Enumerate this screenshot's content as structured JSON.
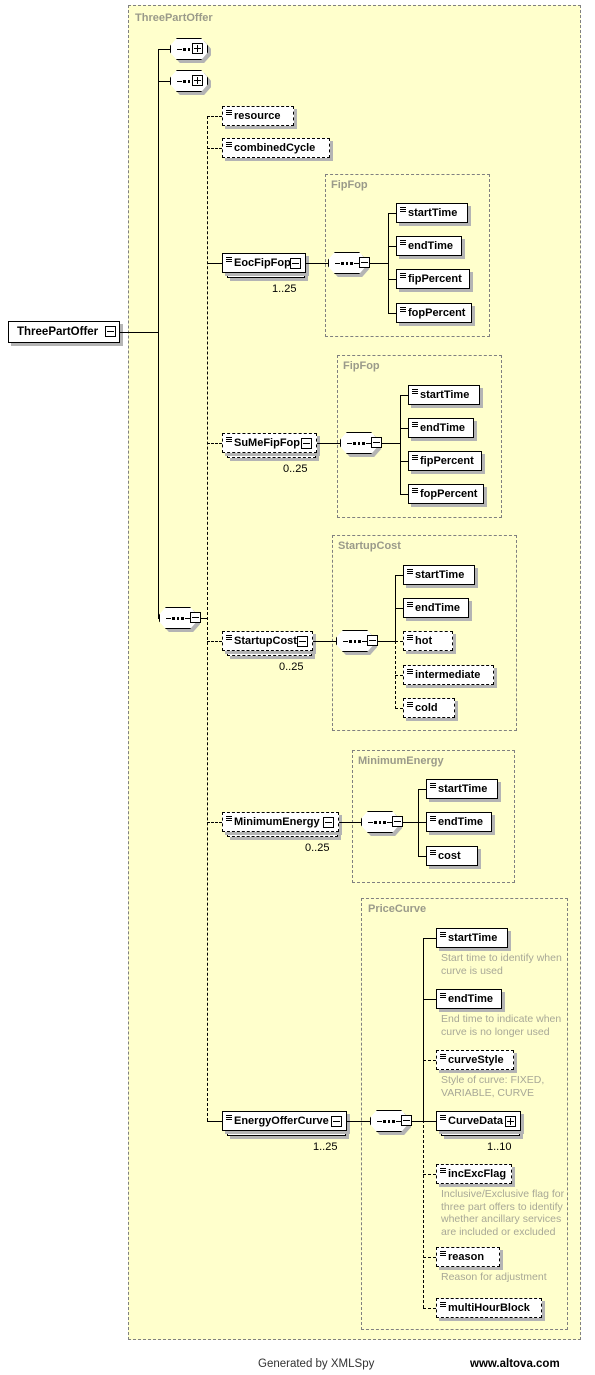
{
  "diagram": {
    "root": {
      "label": "ThreePartOffer",
      "toggle": "minus"
    },
    "container_label": "ThreePartOffer",
    "colors": {
      "background": "#ffffcc",
      "page": "#ffffff",
      "line": "#000000",
      "group_border": "#808080",
      "group_label": "#9a9a8a",
      "annotation": "#a8a897",
      "shadow": "#b4b4b4"
    },
    "collapsed_sequences": [
      {
        "name": "sequence-group-1",
        "toggle": "plus"
      },
      {
        "name": "sequence-group-2",
        "toggle": "plus"
      }
    ],
    "main_sequence": {
      "toggle": "minus"
    },
    "top_optional_elements": [
      {
        "label": "resource",
        "optional": true
      },
      {
        "label": "combinedCycle",
        "optional": true
      }
    ],
    "groups": [
      {
        "id": "eoc-fipfop",
        "group_label": "FipFop",
        "parent": {
          "label": "EocFipFop",
          "occurrence": "1..25",
          "optional": false,
          "toggle": "minus"
        },
        "children": [
          {
            "label": "startTime",
            "optional": false
          },
          {
            "label": "endTime",
            "optional": false
          },
          {
            "label": "fipPercent",
            "optional": false
          },
          {
            "label": "fopPercent",
            "optional": false
          }
        ]
      },
      {
        "id": "sume-fipfop",
        "group_label": "FipFop",
        "parent": {
          "label": "SuMeFipFop",
          "occurrence": "0..25",
          "optional": true,
          "toggle": "minus"
        },
        "children": [
          {
            "label": "startTime",
            "optional": false
          },
          {
            "label": "endTime",
            "optional": false
          },
          {
            "label": "fipPercent",
            "optional": false
          },
          {
            "label": "fopPercent",
            "optional": false
          }
        ]
      },
      {
        "id": "startup-cost",
        "group_label": "StartupCost",
        "parent": {
          "label": "StartupCost",
          "occurrence": "0..25",
          "optional": true,
          "toggle": "minus"
        },
        "children": [
          {
            "label": "startTime",
            "optional": false
          },
          {
            "label": "endTime",
            "optional": false
          },
          {
            "label": "hot",
            "optional": true
          },
          {
            "label": "intermediate",
            "optional": true
          },
          {
            "label": "cold",
            "optional": true
          }
        ]
      },
      {
        "id": "minimum-energy",
        "group_label": "MinimumEnergy",
        "parent": {
          "label": "MinimumEnergy",
          "occurrence": "0..25",
          "optional": true,
          "toggle": "minus"
        },
        "children": [
          {
            "label": "startTime",
            "optional": false
          },
          {
            "label": "endTime",
            "optional": false
          },
          {
            "label": "cost",
            "optional": false
          }
        ]
      },
      {
        "id": "price-curve",
        "group_label": "PriceCurve",
        "parent": {
          "label": "EnergyOfferCurve",
          "occurrence": "1..25",
          "optional": false,
          "toggle": "minus"
        },
        "children": [
          {
            "label": "startTime",
            "optional": false,
            "annotation": "Start time to identify when curve is used"
          },
          {
            "label": "endTime",
            "optional": false,
            "annotation": "End time to indicate when curve is no longer used"
          },
          {
            "label": "curveStyle",
            "optional": true,
            "annotation": "Style of curve: FIXED, VARIABLE, CURVE"
          },
          {
            "label": "CurveData",
            "optional": false,
            "occurrence": "1..10",
            "toggle": "plus"
          },
          {
            "label": "incExcFlag",
            "optional": true,
            "annotation": "Inclusive/Exclusive flag for three part offers to identify whether ancillary services are included or excluded"
          },
          {
            "label": "reason",
            "optional": true,
            "annotation": "Reason for adjustment"
          },
          {
            "label": "multiHourBlock",
            "optional": true
          }
        ]
      }
    ]
  },
  "footer": {
    "generated_by": "Generated by XMLSpy",
    "website": "www.altova.com"
  }
}
